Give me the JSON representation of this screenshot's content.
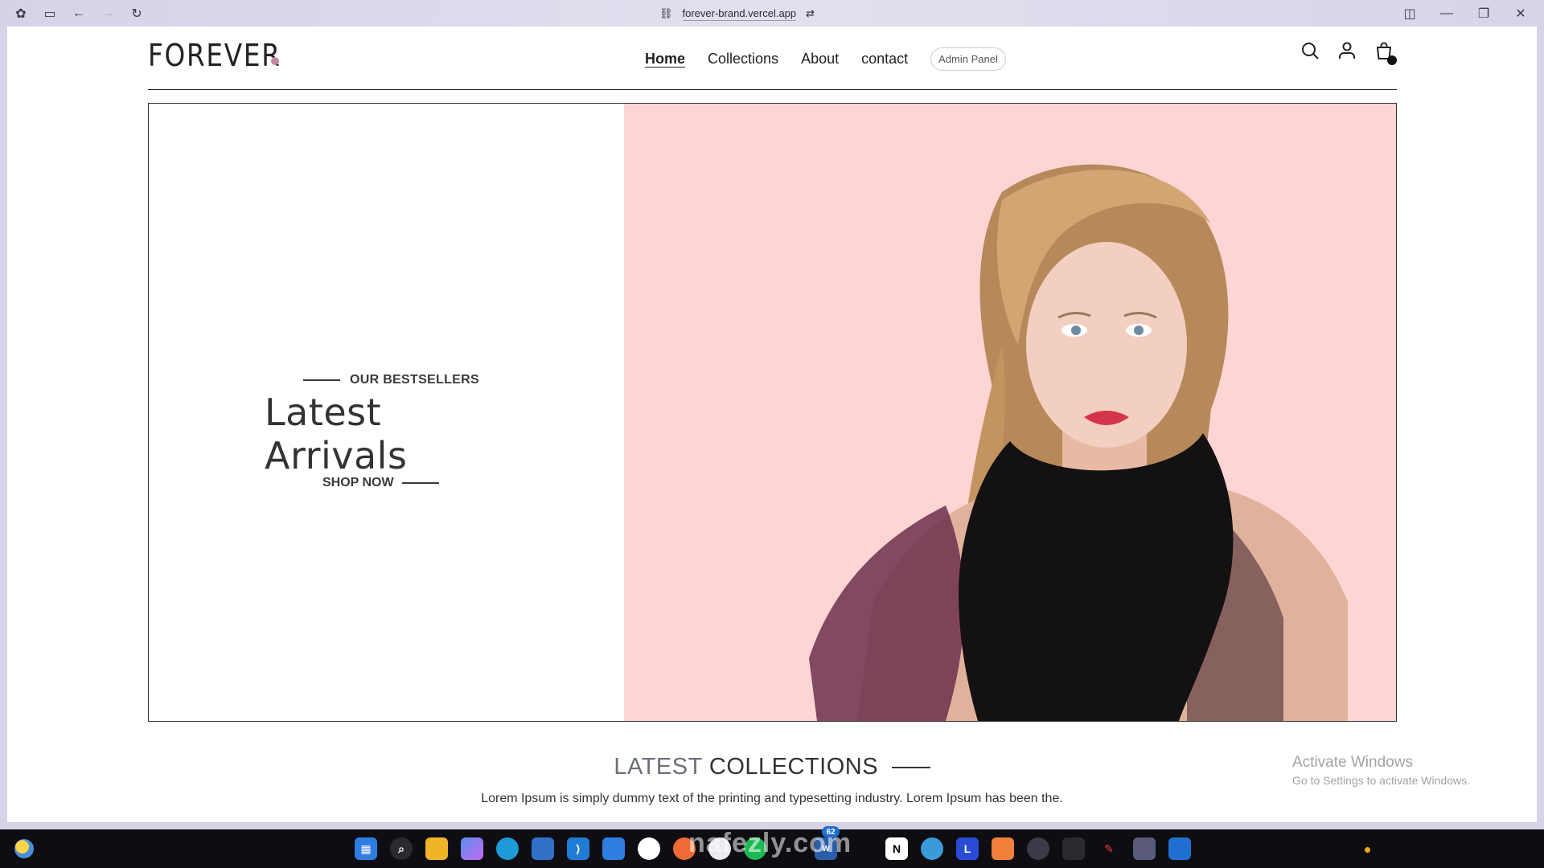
{
  "browser": {
    "url": "forever-brand.vercel.app"
  },
  "header": {
    "logo_text": "FOREVER",
    "nav": [
      {
        "label": "Home",
        "active": true
      },
      {
        "label": "Collections",
        "active": false
      },
      {
        "label": "About",
        "active": false
      },
      {
        "label": "contact",
        "active": false
      }
    ],
    "admin_label": "Admin Panel",
    "icons": [
      "search-icon",
      "user-icon",
      "cart-icon"
    ]
  },
  "hero": {
    "eyebrow": "OUR BESTSELLERS",
    "title": "Latest Arrivals",
    "cta": "SHOP NOW",
    "bg_color": "#fdd5d4"
  },
  "collections": {
    "title_part1": "LATEST",
    "title_part2": "COLLECTIONS",
    "description": "Lorem Ipsum is simply dummy text of the printing and typesetting industry. Lorem Ipsum has been the."
  },
  "windows_notice": {
    "line1": "Activate Windows",
    "line2": "Go to Settings to activate Windows."
  },
  "watermark": "nafezly.com",
  "taskbar": {
    "badge_count": "62",
    "apps": [
      "start-icon",
      "search-icon",
      "explorer-icon",
      "copilot-icon",
      "edge-icon",
      "store-icon",
      "vscode-icon",
      "app-icon",
      "slack-icon",
      "postman-icon",
      "chrome-icon",
      "spotify-icon",
      "xampp-icon",
      "word-icon",
      "notion-icon",
      "browser-icon",
      "l-app-icon",
      "sublime-icon",
      "settings-icon",
      "phone-icon",
      "acrobat-icon",
      "arc-icon",
      "outlook-icon"
    ]
  },
  "accent_color": "#c586a5"
}
